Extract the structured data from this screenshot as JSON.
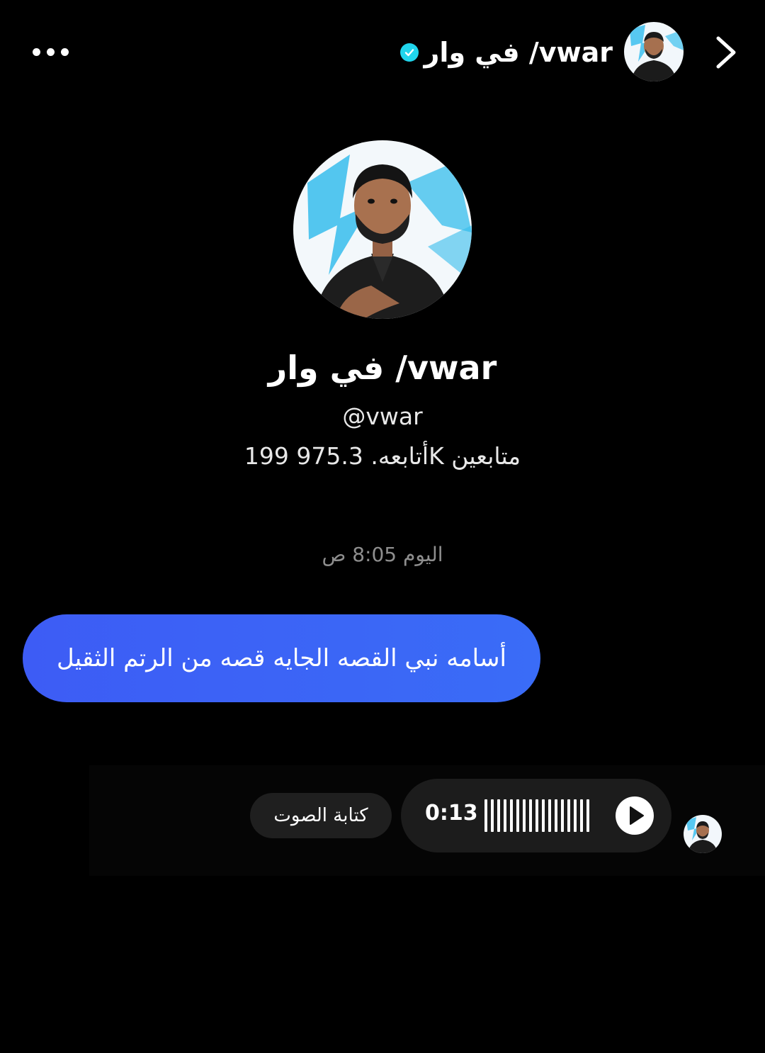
{
  "header": {
    "title": "في وار /vwar",
    "more_icon": "more-horizontal-icon",
    "verified_icon": "verified-check-icon",
    "forward_icon": "chevron-right-icon",
    "verified_color": "#20d5ec"
  },
  "profile": {
    "name": "في وار /vwar",
    "handle": "@vwar",
    "stats": "199 أتابعه. 975.3K متابعين"
  },
  "chat": {
    "timestamp": "اليوم 8:05 ص",
    "message": "أسامه نبي القصه الجايه قصه من الرتم الثقيل",
    "bubble_color": "#3d5cf5",
    "voice": {
      "duration": "0:13",
      "transcribe_label": "كتابة الصوت",
      "play_icon": "play-icon"
    }
  }
}
